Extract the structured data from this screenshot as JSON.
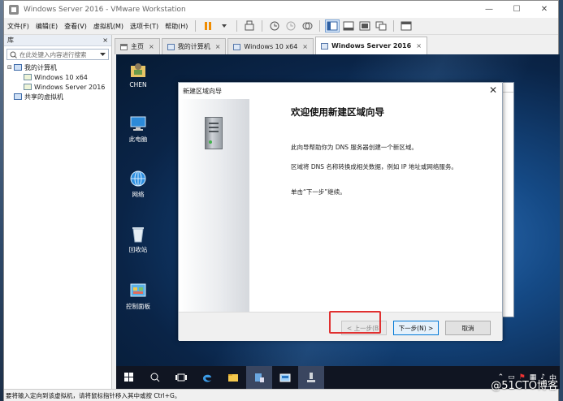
{
  "window": {
    "title": "Windows Server 2016 - VMware Workstation",
    "controls": {
      "minimize": "—",
      "maximize": "☐",
      "close": "✕"
    }
  },
  "menu": {
    "items": [
      "文件(F)",
      "编辑(E)",
      "查看(V)",
      "虚拟机(M)",
      "选项卡(T)",
      "帮助(H)"
    ]
  },
  "library": {
    "title": "库",
    "close": "×",
    "search_placeholder": "在此处键入内容进行搜索",
    "tree": {
      "root": "我的计算机",
      "children": [
        "Windows 10 x64",
        "Windows Server 2016"
      ],
      "shared": "共享的虚拟机"
    }
  },
  "tabs": [
    {
      "label": "主页",
      "icon": "home-icon"
    },
    {
      "label": "我的计算机",
      "icon": "computer-icon"
    },
    {
      "label": "Windows 10 x64",
      "icon": "vm-icon"
    },
    {
      "label": "Windows Server 2016",
      "icon": "vm-icon",
      "active": true
    }
  ],
  "tab_close": "×",
  "desktop": {
    "icons": [
      "CHEN",
      "此电脑",
      "网络",
      "回收站",
      "控制面板"
    ]
  },
  "wizard": {
    "title": "新建区域向导",
    "close": "✕",
    "heading": "欢迎使用新建区域向导",
    "paragraph1": "此向导帮助你为 DNS 服务器创建一个新区域。",
    "paragraph2": "区域将 DNS 名称转换成相关数据，例如 IP 地址或网络服务。",
    "paragraph3": "单击“下一步”继续。",
    "buttons": {
      "back": "< 上一步(B)",
      "next": "下一步(N) >",
      "cancel": "取消"
    }
  },
  "taskbar": {
    "tray_icons": [
      "chevron-up-icon",
      "notification-icon",
      "flag-icon",
      "network-icon",
      "volume-icon",
      "input-method-icon"
    ]
  },
  "statusbar": {
    "text": "要将输入定向到该虚拟机，请将鼠标指针移入其中或按 Ctrl+G。"
  },
  "watermark": "@51CTO博客",
  "colors": {
    "highlight_border": "#e03030",
    "primary_button_border": "#0078d7"
  }
}
